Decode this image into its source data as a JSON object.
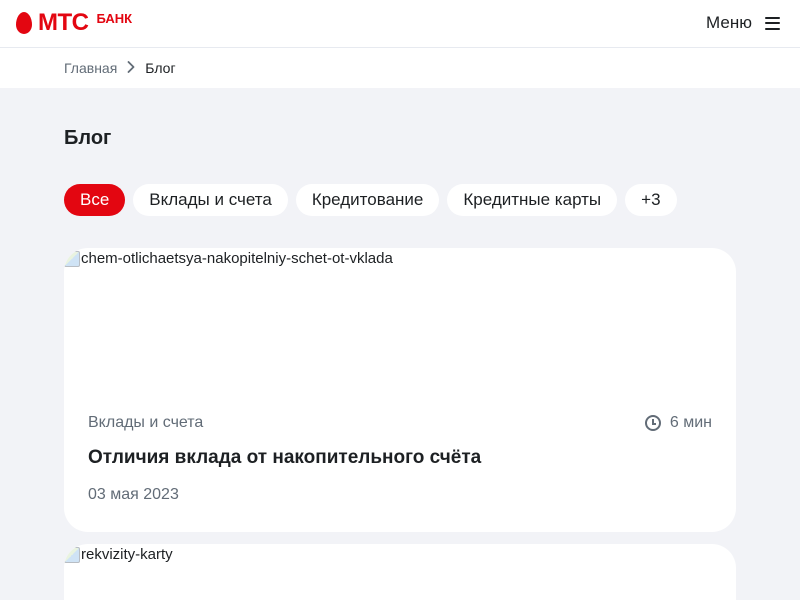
{
  "header": {
    "logo_text": "МТС",
    "logo_sub": "БАНК",
    "menu_label": "Меню"
  },
  "breadcrumbs": {
    "home": "Главная",
    "current": "Блог"
  },
  "page": {
    "title": "Блог"
  },
  "filters": {
    "chips": [
      {
        "label": "Все",
        "active": true
      },
      {
        "label": "Вклады и счета",
        "active": false
      },
      {
        "label": "Кредитование",
        "active": false
      },
      {
        "label": "Кредитные карты",
        "active": false
      },
      {
        "label": "+3",
        "active": false
      }
    ]
  },
  "articles": [
    {
      "image_alt": "chem-otlichaetsya-nakopitelniy-schet-ot-vklada",
      "category": "Вклады и счета",
      "read_time": "6 мин",
      "title": "Отличия вклада от накопительного счёта",
      "date": "03 мая 2023"
    },
    {
      "image_alt": "rekvizity-karty"
    }
  ],
  "colors": {
    "brand": "#e30611",
    "background": "#f2f3f7",
    "text": "#1d2023",
    "secondary_text": "#626c77"
  }
}
